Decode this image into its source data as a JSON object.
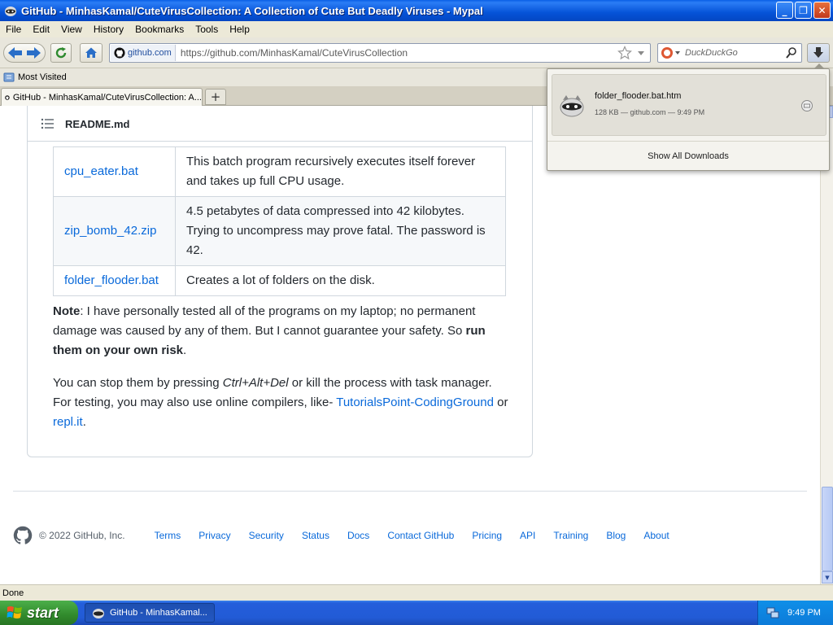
{
  "window": {
    "title": "GitHub - MinhasKamal/CuteVirusCollection: A Collection of Cute But Deadly Viruses - Mypal",
    "minimize": "_",
    "restore": "❐",
    "close": "✕"
  },
  "menu": [
    "File",
    "Edit",
    "View",
    "History",
    "Bookmarks",
    "Tools",
    "Help"
  ],
  "navbar": {
    "site_identity": "github.com",
    "url": "https://github.com/MinhasKamal/CuteVirusCollection",
    "search_placeholder": "DuckDuckGo"
  },
  "bookmarks": {
    "most_visited": "Most Visited"
  },
  "tab": {
    "title": "GitHub - MinhasKamal/CuteVirusCollection: A...",
    "new_tab": "+"
  },
  "readme": {
    "heading": "README.md",
    "rows": [
      {
        "file": "cpu_eater.bat",
        "desc": "This batch program recursively executes itself forever and takes up full CPU usage."
      },
      {
        "file": "zip_bomb_42.zip",
        "desc": "4.5 petabytes of data compressed into 42 kilobytes. Trying to uncompress may prove fatal. The password is 42."
      },
      {
        "file": "folder_flooder.bat",
        "desc": "Creates a lot of folders on the disk."
      }
    ],
    "note_label": "Note",
    "note_text": ": I have personally tested all of the programs on my laptop; no permanent damage was caused by any of them. But I cannot guarantee your safety. So ",
    "note_bold": "run them on your own risk",
    "note_end": ".",
    "stop_text_1": "You can stop them by pressing ",
    "stop_keys": "Ctrl+Alt+Del",
    "stop_text_2": " or kill the process with task manager. For testing, you may also use online compilers, like- ",
    "link_1": "TutorialsPoint-CodingGround",
    "stop_text_3": " or ",
    "link_2": "repl.it",
    "stop_text_4": "."
  },
  "footer": {
    "copyright": "© 2022 GitHub, Inc.",
    "links": [
      "Terms",
      "Privacy",
      "Security",
      "Status",
      "Docs",
      "Contact GitHub",
      "Pricing",
      "API",
      "Training",
      "Blog",
      "About"
    ]
  },
  "status": "Done",
  "downloads": {
    "file_name": "folder_flooder.bat.htm",
    "meta": "128 KB — github.com — 9:49 PM",
    "show_all": "Show All Downloads"
  },
  "taskbar": {
    "start": "start",
    "task_item": "GitHub - MinhasKamal...",
    "clock": "9:49 PM"
  }
}
